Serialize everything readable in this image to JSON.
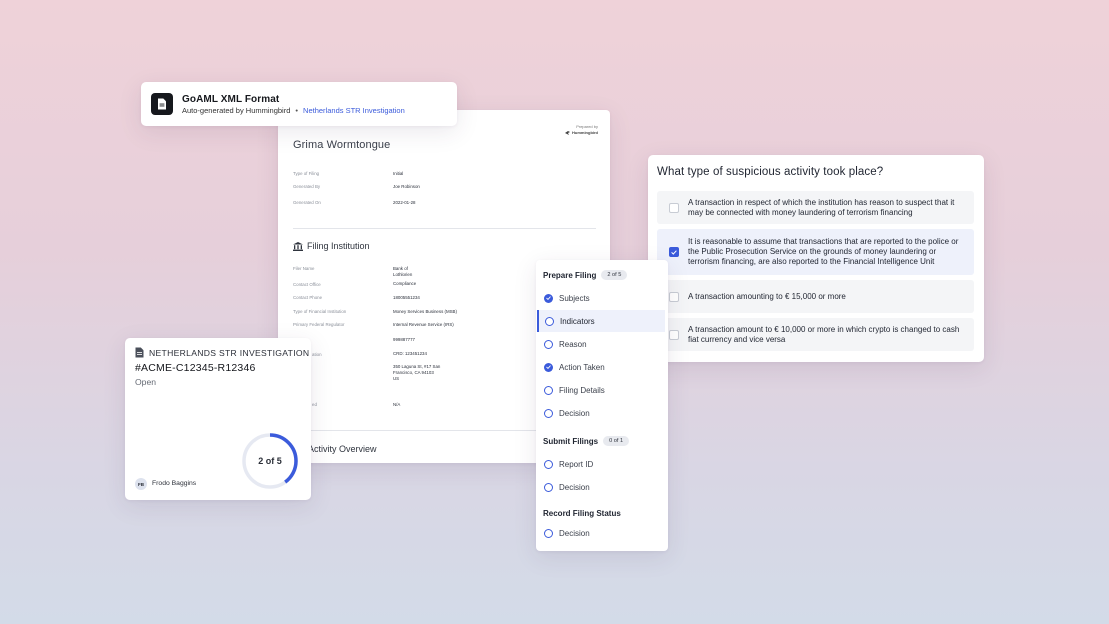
{
  "colors": {
    "accent": "#3b5bdb",
    "ring_track": "#e6e9f2"
  },
  "goaml": {
    "title": "GoAML XML Format",
    "subtitle": "Auto-generated by Hummingbird",
    "separator": "•",
    "link": "Netherlands STR Investigation",
    "icon": "document-icon"
  },
  "report": {
    "prepared_by": "Prepared by",
    "brand": "Hummingbird",
    "subject_name": "Grima Wormtongue",
    "meta": [
      {
        "label": "Type of Filing",
        "value": "Initial"
      },
      {
        "label": "Generated By",
        "value": "Joe Robinson"
      },
      {
        "label": "Generated On",
        "value": "2022-01-28"
      }
    ],
    "institution_title": "Filing Institution",
    "institution_icon": "bank-icon",
    "institution": [
      {
        "label": "Filer Name",
        "value": "Bank of Lothlorien"
      },
      {
        "label": "Contact Office",
        "value": "Compliance"
      },
      {
        "label": "Contact Phone",
        "value": "18005551234"
      },
      {
        "label": "Type of Financial Institution",
        "value": "Money Services Business (MSB)"
      },
      {
        "label": "Primary Federal Regulator",
        "value": "Internal Revenue Service (IRS)"
      },
      {
        "label": "",
        "value": "999887777"
      },
      {
        "label": "ation",
        "value": "CRD: 123451234"
      },
      {
        "label": "",
        "value": "350 Laguna St, #17 San Francisco, CA 94103 US"
      },
      {
        "label": "ed",
        "value": "N/A"
      }
    ],
    "activity_title": "Activity Overview"
  },
  "case": {
    "header": "NETHERLANDS STR INVESTIGATION",
    "header_icon": "document-icon",
    "case_id": "#ACME-C12345-R12346",
    "status": "Open",
    "owner_initials": "FB",
    "owner_name": "Frodo Baggins",
    "progress_label": "2 of 5",
    "progress_done": 2,
    "progress_total": 5
  },
  "steps": {
    "groups": [
      {
        "title": "Prepare Filing",
        "count": "2 of 5",
        "items": [
          {
            "label": "Subjects",
            "state": "done"
          },
          {
            "label": "Indicators",
            "state": "active"
          },
          {
            "label": "Reason",
            "state": "open"
          },
          {
            "label": "Action Taken",
            "state": "done"
          },
          {
            "label": "Filing Details",
            "state": "open"
          },
          {
            "label": "Decision",
            "state": "open"
          }
        ]
      },
      {
        "title": "Submit Filings",
        "count": "0 of 1",
        "items": [
          {
            "label": "Report ID",
            "state": "open"
          },
          {
            "label": "Decision",
            "state": "open"
          }
        ]
      },
      {
        "title": "Record Filing Status",
        "count": "",
        "items": [
          {
            "label": "Decision",
            "state": "open"
          }
        ]
      }
    ]
  },
  "question": {
    "title": "What type of suspicious activity took place?",
    "options": [
      {
        "text": "A transaction in respect of which the institution has reason to suspect that it may be connected with money laundering of terrorism financing",
        "checked": false
      },
      {
        "text": "It is reasonable to assume that transactions that are reported to the police or the Public Prosecution Service on the grounds of money laundering or terrorism financing, are also reported to the Financial Intelligence Unit",
        "checked": true
      },
      {
        "text": "A transaction amounting to € 15,000 or more",
        "checked": false
      },
      {
        "text": "A transaction amount to € 10,000 or more in which crypto is changed to cash fiat currency and vice versa",
        "checked": false
      }
    ]
  }
}
